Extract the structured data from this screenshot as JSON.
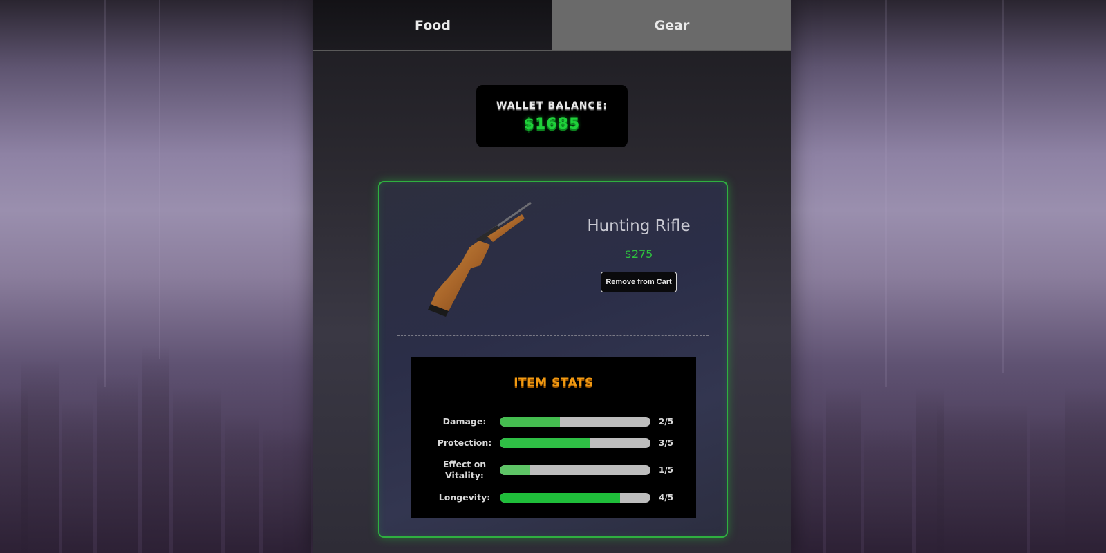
{
  "tabs": [
    {
      "label": "Food",
      "active": false
    },
    {
      "label": "Gear",
      "active": true
    }
  ],
  "wallet": {
    "label": "WALLET BALANCE:",
    "amount": "$1685"
  },
  "item": {
    "name": "Hunting Rifle",
    "price": "$275",
    "remove_label": "Remove from Cart",
    "image_icon": "hunting-rifle-image"
  },
  "stats": {
    "title": "ITEM STATS",
    "rows": [
      {
        "label": "Damage:",
        "value_text": "2/5",
        "level": 0.4,
        "color": "#45bd50"
      },
      {
        "label": "Protection:",
        "value_text": "3/5",
        "level": 0.6,
        "color": "#2fbf45"
      },
      {
        "label": "Effect on Vitality:",
        "value_text": "1/5",
        "level": 0.2,
        "color": "#5ec466"
      },
      {
        "label": "Longevity:",
        "value_text": "4/5",
        "level": 0.8,
        "color": "#1fbd3a"
      }
    ]
  },
  "colors": {
    "accent_green": "#2ec43f",
    "stats_title_orange": "#f29a12",
    "card_border": "#2fb040"
  }
}
